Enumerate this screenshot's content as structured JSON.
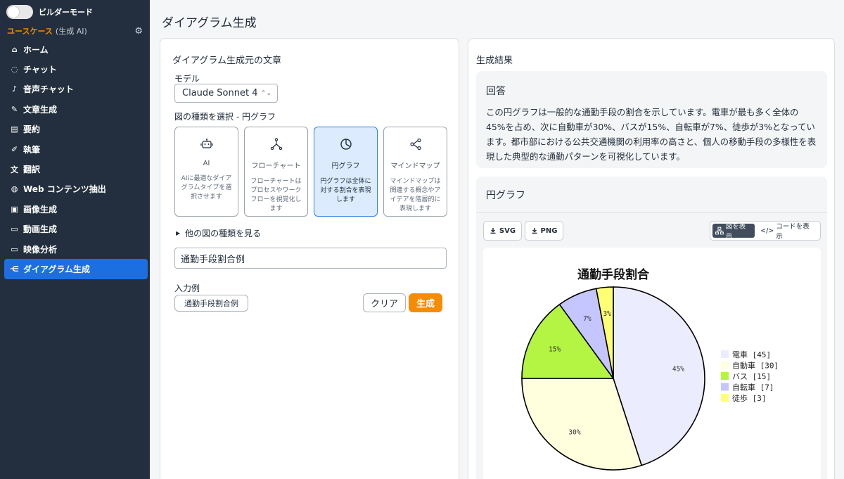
{
  "sidebar": {
    "builder_label": "ビルダーモード",
    "usecase_label": "ユースケース",
    "usecase_sub": "(生成 AI)",
    "items": [
      {
        "label": "ホーム",
        "icon": "home-icon"
      },
      {
        "label": "チャット",
        "icon": "chat-icon"
      },
      {
        "label": "音声チャット",
        "icon": "mic-icon"
      },
      {
        "label": "文章生成",
        "icon": "pencil-icon"
      },
      {
        "label": "要約",
        "icon": "document-icon"
      },
      {
        "label": "執筆",
        "icon": "pen-icon"
      },
      {
        "label": "翻訳",
        "icon": "translate-icon"
      },
      {
        "label": "Web コンテンツ抽出",
        "icon": "globe-icon"
      },
      {
        "label": "画像生成",
        "icon": "image-icon"
      },
      {
        "label": "動画生成",
        "icon": "video-icon"
      },
      {
        "label": "映像分析",
        "icon": "camera-icon"
      },
      {
        "label": "ダイアグラム生成",
        "icon": "diagram-icon",
        "active": true
      }
    ]
  },
  "page": {
    "title": "ダイアグラム生成"
  },
  "input_panel": {
    "title": "ダイアグラム生成元の文章",
    "model_label": "モデル",
    "model_value": "Claude Sonnet 4",
    "type_label": "図の種類を選択 - 円グラフ",
    "types": [
      {
        "name": "AI",
        "desc": "AIに最適なダイアグラムタイプを選択させます",
        "icon": "robot-icon"
      },
      {
        "name": "フローチャート",
        "desc": "フローチャートはプロセスやワークフローを視覚化します",
        "icon": "flowchart-icon"
      },
      {
        "name": "円グラフ",
        "desc": "円グラフは全体に対する割合を表現します",
        "icon": "pie-chart-icon",
        "selected": true
      },
      {
        "name": "マインドマップ",
        "desc": "マインドマップは関連する概念やアイデアを階層的に表現します",
        "icon": "mindmap-icon"
      }
    ],
    "more_types": "他の図の種類を見る",
    "text_value": "通勤手段割合例",
    "example_label": "入力例",
    "example_button": "通勤手段割合例",
    "clear_button": "クリア",
    "generate_button": "生成"
  },
  "result_panel": {
    "title": "生成結果",
    "answer_title": "回答",
    "answer_text": "この円グラフは一般的な通勤手段の割合を示しています。電車が最も多く全体の45%を占め、次に自動車が30%、バスが15%、自転車が7%、徒歩が3%となっています。都市部における公共交通機関の利用率の高さと、個人の移動手段の多様性を表現した典型的な通勤パターンを可視化しています。",
    "chart_section_title": "円グラフ",
    "svg_button": "SVG",
    "png_button": "PNG",
    "view_diagram": "図を表示",
    "view_code": "コードを表示"
  },
  "chart_data": {
    "type": "pie",
    "title": "通勤手段割合",
    "categories": [
      "電車",
      "自動車",
      "バス",
      "自転車",
      "徒歩"
    ],
    "values": [
      45,
      30,
      15,
      7,
      3
    ],
    "colors": [
      "#ececff",
      "#ffffde",
      "#b4f442",
      "#c5c5ff",
      "#ffff73"
    ],
    "legend_position": "right"
  }
}
